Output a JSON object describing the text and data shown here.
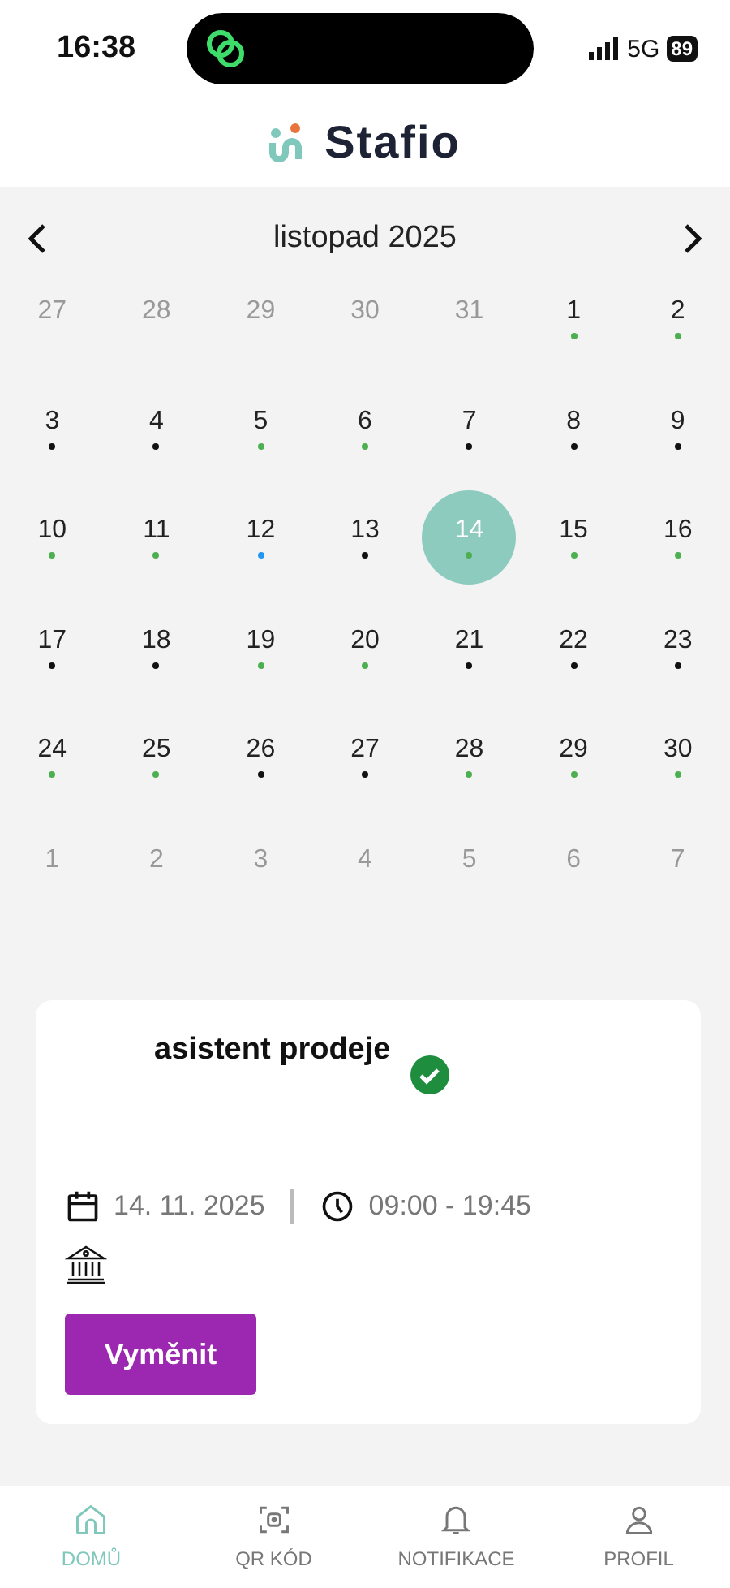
{
  "status_bar": {
    "time": "16:38",
    "network": "5G",
    "battery": "89"
  },
  "app_header": {
    "logo": "Stafio"
  },
  "calendar": {
    "month": "listopad 2025",
    "days": [
      {
        "day": "27",
        "in_month": false,
        "selected": false
      },
      {
        "day": "28",
        "in_month": false,
        "selected": false
      },
      {
        "day": "29",
        "in_month": false,
        "selected": false
      },
      {
        "day": "30",
        "in_month": false,
        "selected": false
      },
      {
        "day": "31",
        "in_month": false,
        "selected": false
      },
      {
        "day": "1",
        "in_month": true,
        "selected": false,
        "color": "#4caf50"
      },
      {
        "day": "2",
        "in_month": true,
        "selected": false,
        "color": "#4caf50"
      },
      {
        "day": "3",
        "in_month": true,
        "selected": false,
        "color": "#111111"
      },
      {
        "day": "4",
        "in_month": true,
        "selected": false,
        "color": "#111111"
      },
      {
        "day": "5",
        "in_month": true,
        "selected": false,
        "color": "#4caf50"
      },
      {
        "day": "6",
        "in_month": true,
        "selected": false,
        "color": "#4caf50"
      },
      {
        "day": "7",
        "in_month": true,
        "selected": false,
        "color": "#111111"
      },
      {
        "day": "8",
        "in_month": true,
        "selected": false,
        "color": "#111111"
      },
      {
        "day": "9",
        "in_month": true,
        "selected": false,
        "color": "#111111"
      },
      {
        "day": "10",
        "in_month": true,
        "selected": false,
        "color": "#4caf50"
      },
      {
        "day": "11",
        "in_month": true,
        "selected": false,
        "color": "#4caf50"
      },
      {
        "day": "12",
        "in_month": true,
        "selected": false,
        "color": "#2196f3"
      },
      {
        "day": "13",
        "in_month": true,
        "selected": false,
        "color": "#111111"
      },
      {
        "day": "14",
        "in_month": true,
        "selected": true,
        "color": "#4caf50"
      },
      {
        "day": "15",
        "in_month": true,
        "selected": false,
        "color": "#4caf50"
      },
      {
        "day": "16",
        "in_month": true,
        "selected": false,
        "color": "#4caf50"
      },
      {
        "day": "17",
        "in_month": true,
        "selected": false,
        "color": "#111111"
      },
      {
        "day": "18",
        "in_month": true,
        "selected": false,
        "color": "#111111"
      },
      {
        "day": "19",
        "in_month": true,
        "selected": false,
        "color": "#4caf50"
      },
      {
        "day": "20",
        "in_month": true,
        "selected": false,
        "color": "#4caf50"
      },
      {
        "day": "21",
        "in_month": true,
        "selected": false,
        "color": "#111111"
      },
      {
        "day": "22",
        "in_month": true,
        "selected": false,
        "color": "#111111"
      },
      {
        "day": "23",
        "in_month": true,
        "selected": false,
        "color": "#111111"
      },
      {
        "day": "24",
        "in_month": true,
        "selected": false,
        "color": "#4caf50"
      },
      {
        "day": "25",
        "in_month": true,
        "selected": false,
        "color": "#4caf50"
      },
      {
        "day": "26",
        "in_month": true,
        "selected": false,
        "color": "#111111"
      },
      {
        "day": "27",
        "in_month": true,
        "selected": false,
        "color": "#111111"
      },
      {
        "day": "28",
        "in_month": true,
        "selected": false,
        "color": "#4caf50"
      },
      {
        "day": "29",
        "in_month": true,
        "selected": false,
        "color": "#4caf50"
      },
      {
        "day": "30",
        "in_month": true,
        "selected": false,
        "color": "#4caf50"
      },
      {
        "day": "1",
        "in_month": false,
        "selected": false
      },
      {
        "day": "2",
        "in_month": false,
        "selected": false
      },
      {
        "day": "3",
        "in_month": false,
        "selected": false
      },
      {
        "day": "4",
        "in_month": false,
        "selected": false
      },
      {
        "day": "5",
        "in_month": false,
        "selected": false
      },
      {
        "day": "6",
        "in_month": false,
        "selected": false
      },
      {
        "day": "7",
        "in_month": false,
        "selected": false
      }
    ]
  },
  "shift_card": {
    "title": "asistent prodeje",
    "confirmed": true,
    "date": "14. 11. 2025",
    "time": "09:00 - 19:45",
    "button": "Vyměnit"
  },
  "bottom_nav": [
    {
      "kind": "home",
      "label": "DOMŮ",
      "selected": true
    },
    {
      "kind": "qr",
      "label": "QR KÓD",
      "selected": false
    },
    {
      "kind": "bell",
      "label": "NOTIFIKACE",
      "selected": false
    },
    {
      "kind": "user",
      "label": "PROFIL",
      "selected": false
    }
  ]
}
